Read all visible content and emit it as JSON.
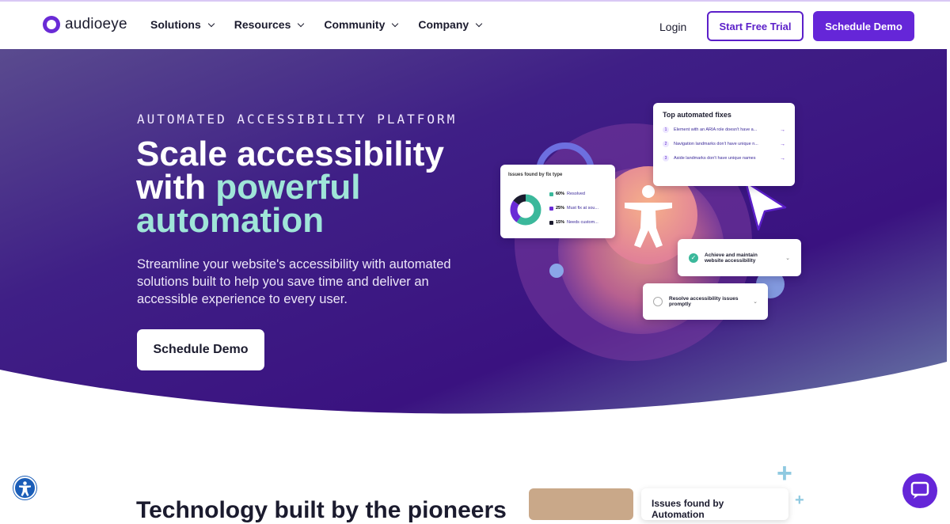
{
  "header": {
    "logo_text": "audioeye",
    "nav": [
      {
        "label": "Solutions"
      },
      {
        "label": "Resources"
      },
      {
        "label": "Community"
      },
      {
        "label": "Company"
      }
    ],
    "login": "Login",
    "trial_button": "Start Free Trial",
    "demo_button": "Schedule Demo"
  },
  "hero": {
    "eyebrow": "AUTOMATED ACCESSIBILITY PLATFORM",
    "headline_part1": "Scale accessibility with ",
    "headline_accent": "powerful automation",
    "lead": "Streamline your website's accessibility with automated solutions built to help you save time and deliver an accessible experience to every user.",
    "cta": "Schedule Demo",
    "cards": {
      "top_fixes": {
        "title": "Top automated fixes",
        "items": [
          {
            "n": "1",
            "text": "Element with an ARIA role doesn't have a..."
          },
          {
            "n": "2",
            "text": "Navigation landmarks don't have unique n..."
          },
          {
            "n": "3",
            "text": "Aside landmarks don't have unique names"
          }
        ]
      },
      "issues": {
        "title": "Issues found by fix type",
        "rows": [
          {
            "pct": "60%",
            "label": "Resolved",
            "color": "#3bb89b"
          },
          {
            "pct": "25%",
            "label": "Must fix at sou...",
            "color": "#6a2bd6"
          },
          {
            "pct": "15%",
            "label": "Needs custom...",
            "color": "#1b1b2e"
          }
        ]
      },
      "achieve": {
        "text": "Achieve and maintain website accessibility"
      },
      "resolve": {
        "text": "Resolve accessibility issues promptly"
      }
    }
  },
  "section2": {
    "title": "Technology built by the pioneers",
    "preview_card_title": "Issues found by Automation"
  },
  "colors": {
    "brand": "#6526d8",
    "accent": "#9fe5d8"
  }
}
